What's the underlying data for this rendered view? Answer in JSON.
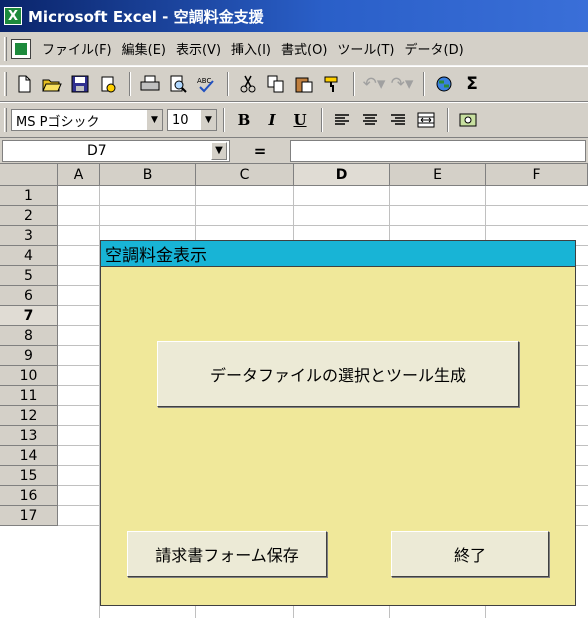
{
  "window": {
    "title": "Microsoft Excel - 空調料金支援",
    "app_icon": "X"
  },
  "menu": [
    "ファイル(F)",
    "編集(E)",
    "表示(V)",
    "挿入(I)",
    "書式(O)",
    "ツール(T)",
    "データ(D)"
  ],
  "toolbar": {
    "icons": [
      "new-icon",
      "open-icon",
      "save-icon",
      "permission-icon",
      "print-icon",
      "print-preview-icon",
      "spelling-icon",
      "cut-icon",
      "copy-icon",
      "paste-icon",
      "format-painter-icon",
      "undo-icon",
      "redo-icon",
      "hyperlink-icon",
      "autosum-icon"
    ],
    "autosum_glyph": "Σ"
  },
  "format_toolbar": {
    "font": "MS Pゴシック",
    "size": "10",
    "bold": "B",
    "italic": "I",
    "underline": "U"
  },
  "formula_bar": {
    "name_box": "D7",
    "equals": "=",
    "value": ""
  },
  "columns": [
    "A",
    "B",
    "C",
    "D",
    "E",
    "F"
  ],
  "active_column": "D",
  "rows": [
    "1",
    "2",
    "3",
    "4",
    "5",
    "6",
    "7",
    "8",
    "9",
    "10",
    "11",
    "12",
    "13",
    "14",
    "15",
    "16",
    "17"
  ],
  "active_row": "7",
  "panel": {
    "title": "空調料金表示",
    "background": "#f0e89a",
    "title_background": "#18b4d6",
    "buttons": {
      "select_data": "データファイルの選択とツール生成",
      "save_invoice": "請求書フォーム保存",
      "exit": "終了"
    }
  }
}
